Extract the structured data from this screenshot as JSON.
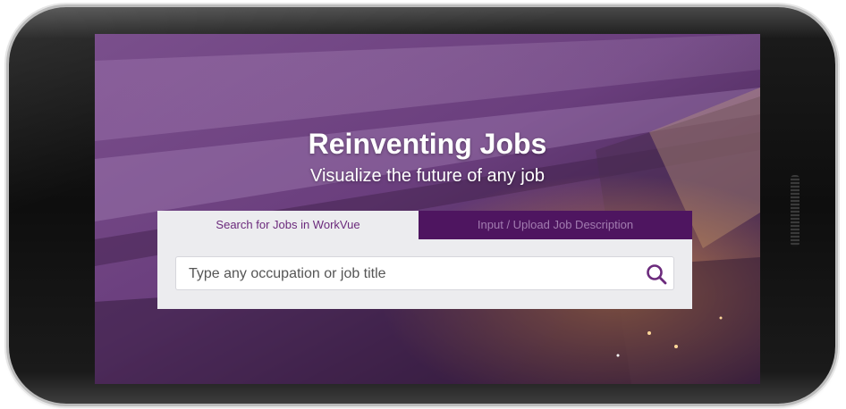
{
  "hero": {
    "title": "Reinventing Jobs",
    "subtitle": "Visualize the future of any job"
  },
  "tabs": [
    {
      "label": "Search for Jobs in WorkVue",
      "active": true
    },
    {
      "label": "Input / Upload Job Description",
      "active": false
    }
  ],
  "search": {
    "placeholder": "Type any occupation or job title",
    "value": "",
    "icon": "search-icon"
  },
  "colors": {
    "accent": "#6b2a7c",
    "tab_inactive_bg": "#4e1560",
    "panel_bg": "#ececef"
  }
}
